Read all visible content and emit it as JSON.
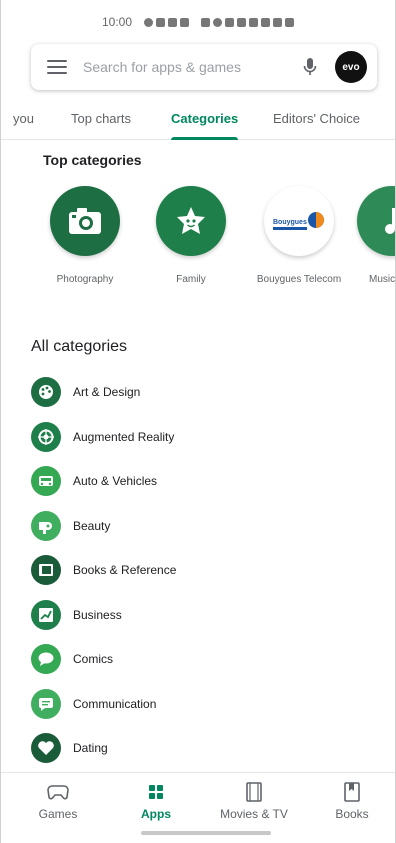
{
  "status_bar": {
    "time": "10:00"
  },
  "search": {
    "placeholder": "Search for apps & games",
    "avatar_text": "evo"
  },
  "tabs": [
    {
      "label": "you"
    },
    {
      "label": "Top charts"
    },
    {
      "label": "Categories",
      "active": true
    },
    {
      "label": "Editors' Choice"
    }
  ],
  "top_categories": {
    "title": "Top categories",
    "items": [
      {
        "label": "Photography",
        "icon": "camera-icon"
      },
      {
        "label": "Family",
        "icon": "star-face-icon"
      },
      {
        "label": "Bouygues Telecom",
        "icon": "bouygues-logo-icon"
      },
      {
        "label": "Music",
        "icon": "music-note-icon"
      }
    ]
  },
  "all_categories": {
    "title": "All categories",
    "items": [
      {
        "label": "Art & Design",
        "icon": "palette-icon"
      },
      {
        "label": "Augmented Reality",
        "icon": "ar-icon"
      },
      {
        "label": "Auto & Vehicles",
        "icon": "car-icon"
      },
      {
        "label": "Beauty",
        "icon": "hairdryer-icon"
      },
      {
        "label": "Books & Reference",
        "icon": "book-icon"
      },
      {
        "label": "Business",
        "icon": "chart-icon"
      },
      {
        "label": "Comics",
        "icon": "speech-bubble-icon"
      },
      {
        "label": "Communication",
        "icon": "chat-icon"
      },
      {
        "label": "Dating",
        "icon": "heart-icon"
      }
    ]
  },
  "bottom_nav": [
    {
      "label": "Games",
      "icon": "gamepad-icon"
    },
    {
      "label": "Apps",
      "icon": "apps-grid-icon",
      "active": true
    },
    {
      "label": "Movies & TV",
      "icon": "film-icon"
    },
    {
      "label": "Books",
      "icon": "bookmark-icon"
    }
  ],
  "colors": {
    "accent": "#01875f",
    "dark_green": "#1e6e44",
    "mid_green": "#2e8b57",
    "light_green": "#34a853"
  }
}
